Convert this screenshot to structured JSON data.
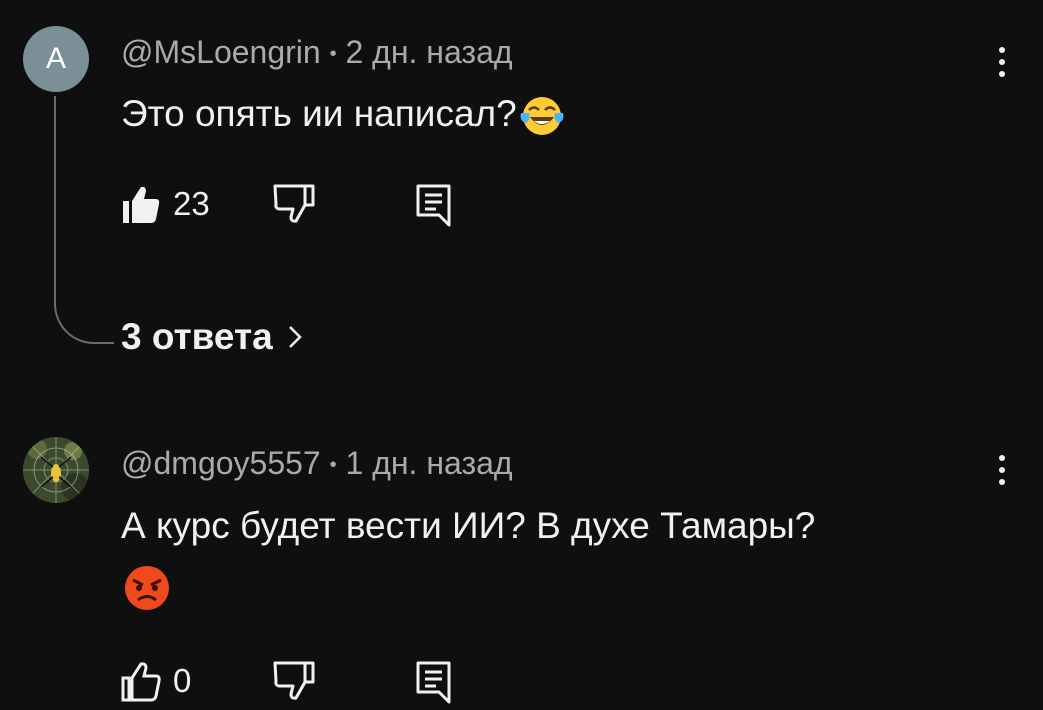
{
  "comments": [
    {
      "avatar_letter": "A",
      "avatar_color": "#7a8f98",
      "author": "@MsLoengrin",
      "time": "2 дн. назад",
      "separator": "•",
      "text": "Это опять ии написал?",
      "emoji": "face-with-tears-of-joy",
      "likes": "23",
      "replies_label": "3 ответа"
    },
    {
      "avatar_image": "spider-on-web-photo",
      "author": "@dmgoy5557",
      "time": "1 дн. назад",
      "separator": "•",
      "text": "А курс будет вести ИИ? В духе Тамары?",
      "emoji": "angry-face",
      "likes": "0"
    }
  ],
  "colors": {
    "background": "#0f0f0f",
    "primary_text": "#f1f1f1",
    "secondary_text": "#aaaaaa",
    "thread_line": "#6b6b6b",
    "emoji_yellow": "#ffcc33",
    "emoji_angry": "#f04a1c"
  },
  "icons": [
    "like-icon",
    "dislike-icon",
    "reply-icon",
    "more-vertical-icon",
    "chevron-right-icon"
  ]
}
